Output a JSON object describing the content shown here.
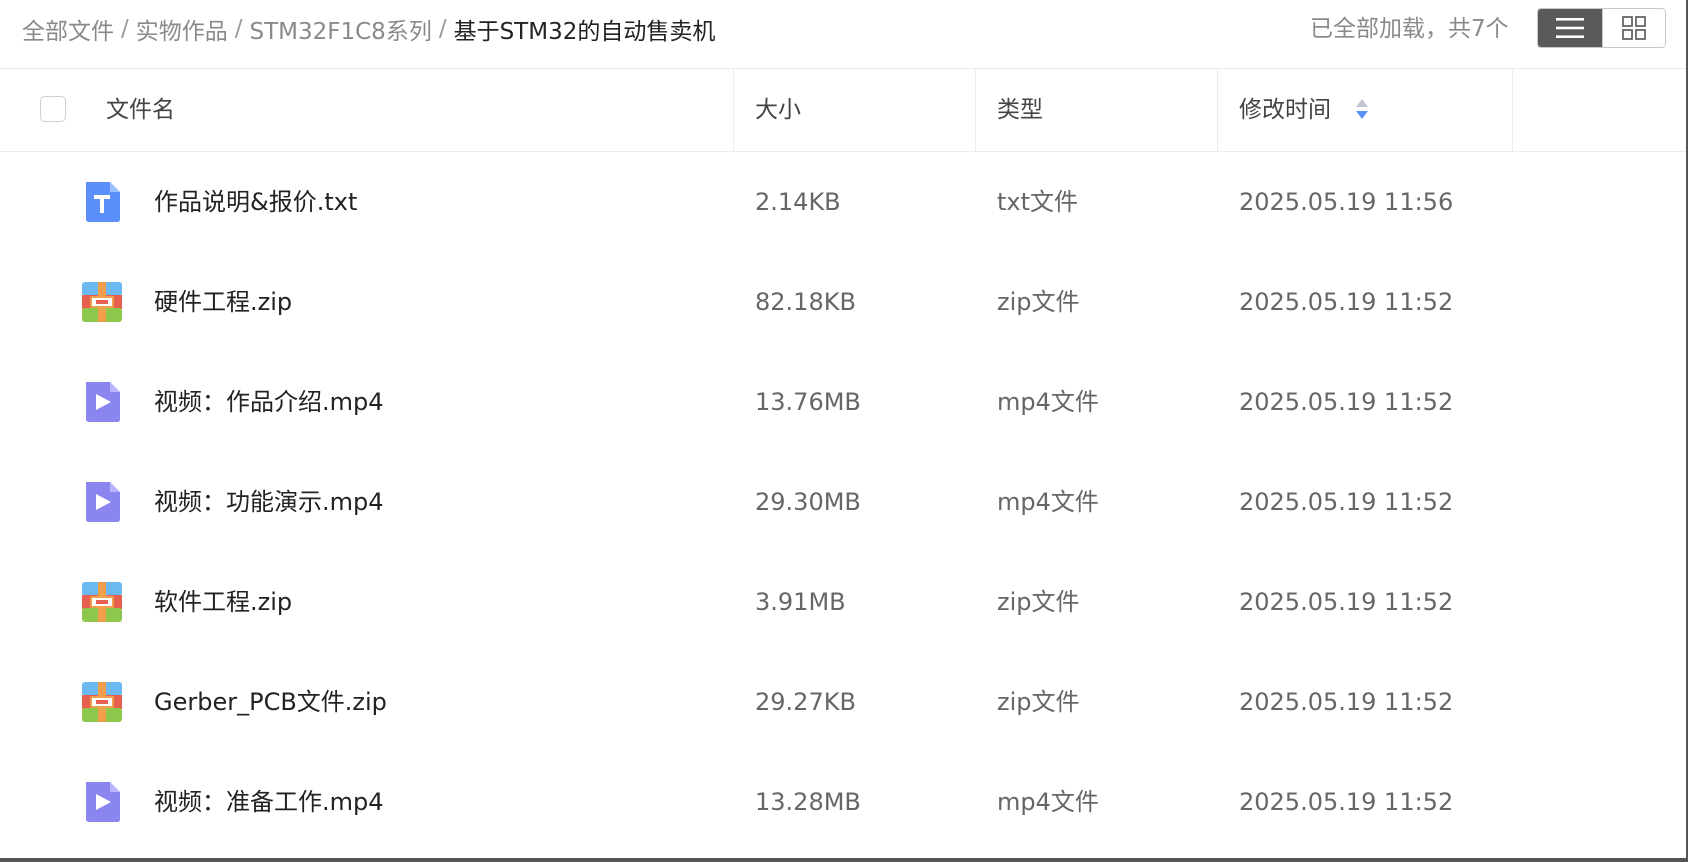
{
  "breadcrumb": {
    "items": [
      "全部文件",
      "实物作品",
      "STM32F1C8系列",
      "基于STM32的自动售卖机"
    ],
    "separator": "/"
  },
  "status": {
    "loaded_text": "已全部加载，共7个"
  },
  "view_toggle": {
    "active": "list-view",
    "options": [
      "list-view-icon",
      "grid-view-icon"
    ]
  },
  "table": {
    "headers": {
      "name": "文件名",
      "size": "大小",
      "type": "类型",
      "modified": "修改时间"
    },
    "sort": {
      "column": "修改时间",
      "icon": "sort-icon"
    },
    "rows": [
      {
        "icon": "txt-file-icon",
        "name": "作品说明&报价.txt",
        "size": "2.14KB",
        "type": "txt文件",
        "modified": "2025.05.19 11:56"
      },
      {
        "icon": "zip-archive-icon",
        "name": "硬件工程.zip",
        "size": "82.18KB",
        "type": "zip文件",
        "modified": "2025.05.19 11:52"
      },
      {
        "icon": "video-file-icon",
        "name": "视频：作品介绍.mp4",
        "size": "13.76MB",
        "type": "mp4文件",
        "modified": "2025.05.19 11:52"
      },
      {
        "icon": "video-file-icon",
        "name": "视频：功能演示.mp4",
        "size": "29.30MB",
        "type": "mp4文件",
        "modified": "2025.05.19 11:52"
      },
      {
        "icon": "zip-archive-icon",
        "name": "软件工程.zip",
        "size": "3.91MB",
        "type": "zip文件",
        "modified": "2025.05.19 11:52"
      },
      {
        "icon": "zip-archive-icon",
        "name": "Gerber_PCB文件.zip",
        "size": "29.27KB",
        "type": "zip文件",
        "modified": "2025.05.19 11:52"
      },
      {
        "icon": "video-file-icon",
        "name": "视频：准备工作.mp4",
        "size": "13.28MB",
        "type": "mp4文件",
        "modified": "2025.05.19 11:52"
      }
    ]
  },
  "colors": {
    "txt_icon": "#5b8ff9",
    "video_icon": "#8b85f0",
    "zip_top": "#6cb8f0",
    "zip_mid": "#e7604f",
    "zip_bottom": "#8cc84b",
    "zip_strap": "#f0a04b",
    "sort_up": "#c0c4cc",
    "sort_down": "#5b8ff9",
    "toggle_active": "#5a5a5a"
  }
}
